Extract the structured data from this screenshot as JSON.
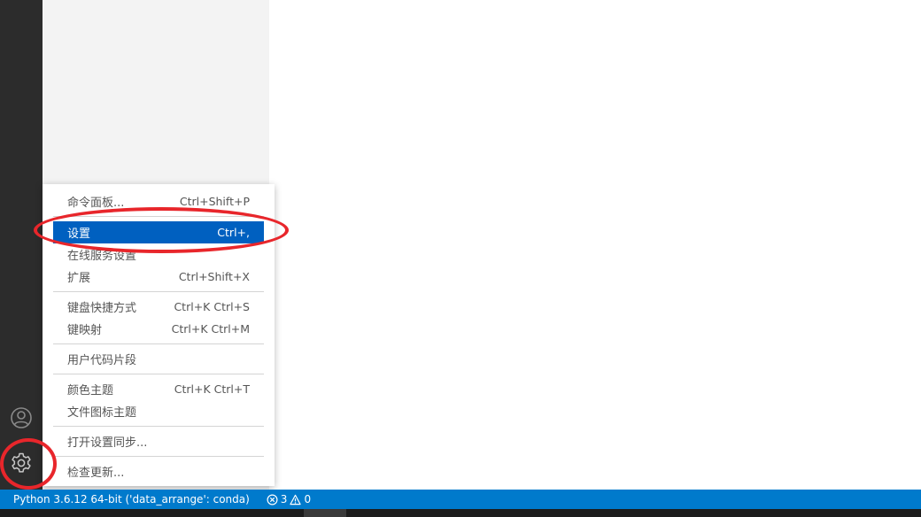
{
  "activity_bar": {
    "icons": [
      "account-icon",
      "gear-icon"
    ]
  },
  "menu": {
    "items": [
      {
        "label": "命令面板...",
        "shortcut": "Ctrl+Shift+P"
      },
      {
        "label": "设置",
        "shortcut": "Ctrl+,",
        "selected": true
      },
      {
        "label": "在线服务设置",
        "shortcut": ""
      },
      {
        "label": "扩展",
        "shortcut": "Ctrl+Shift+X"
      },
      {
        "label": "键盘快捷方式",
        "shortcut": "Ctrl+K Ctrl+S"
      },
      {
        "label": "键映射",
        "shortcut": "Ctrl+K Ctrl+M"
      },
      {
        "label": "用户代码片段",
        "shortcut": ""
      },
      {
        "label": "颜色主题",
        "shortcut": "Ctrl+K Ctrl+T"
      },
      {
        "label": "文件图标主题",
        "shortcut": ""
      },
      {
        "label": "打开设置同步...",
        "shortcut": ""
      },
      {
        "label": "检查更新...",
        "shortcut": ""
      }
    ]
  },
  "status_bar": {
    "interpreter": "Python 3.6.12 64-bit ('data_arrange': conda)",
    "errors": "3",
    "warnings": "0"
  },
  "colors": {
    "activity_bar": "#2c2c2c",
    "side_panel": "#f3f3f3",
    "status_bar": "#007acc",
    "selection": "#0060c0",
    "annotation": "#e8262b"
  }
}
